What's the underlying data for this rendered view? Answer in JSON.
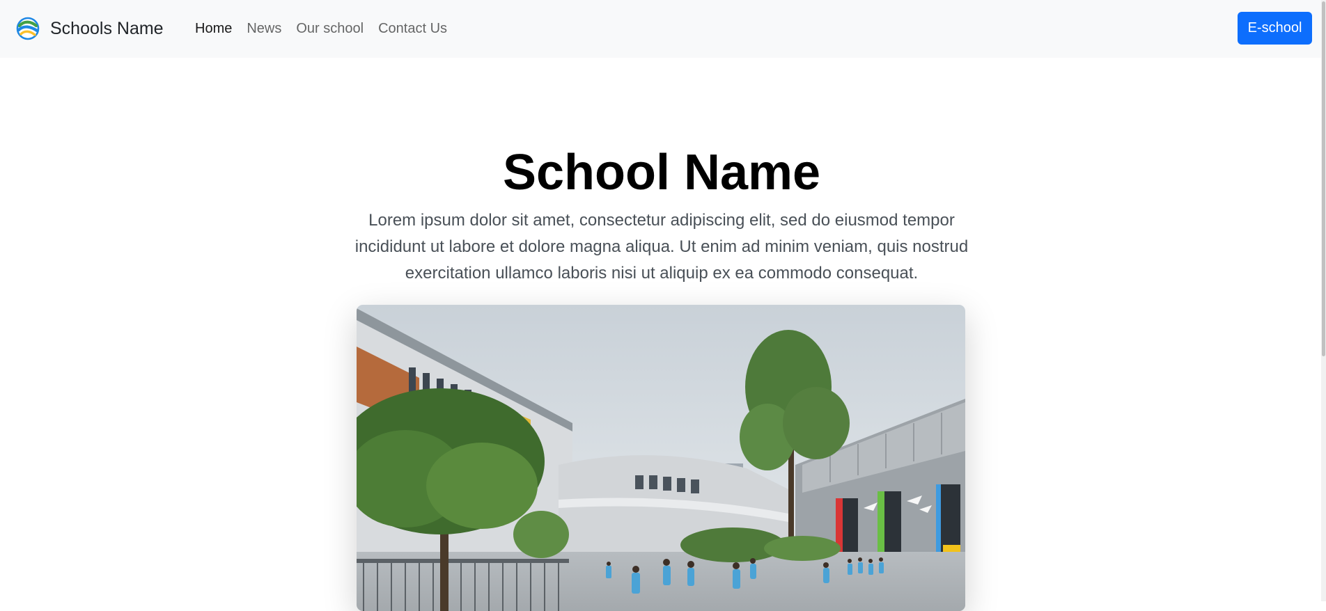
{
  "navbar": {
    "brand_name": "Schools Name",
    "logo_icon": "school-logo-icon",
    "links": [
      {
        "label": "Home",
        "active": true
      },
      {
        "label": "News",
        "active": false
      },
      {
        "label": "Our school",
        "active": false
      },
      {
        "label": "Contact Us",
        "active": false
      }
    ],
    "eschool_button": "E-school",
    "button_color": "#0d6efd"
  },
  "hero": {
    "title": "School Name",
    "lead": "Lorem ipsum dolor sit amet, consectetur adipiscing elit, sed do eiusmod tempor incididunt ut labore et dolore magna aliqua. Ut enim ad minim veniam, quis nostrud exercitation ullamco laboris nisi ut aliquip ex ea commodo consequat.",
    "image": "school-building-photo"
  }
}
